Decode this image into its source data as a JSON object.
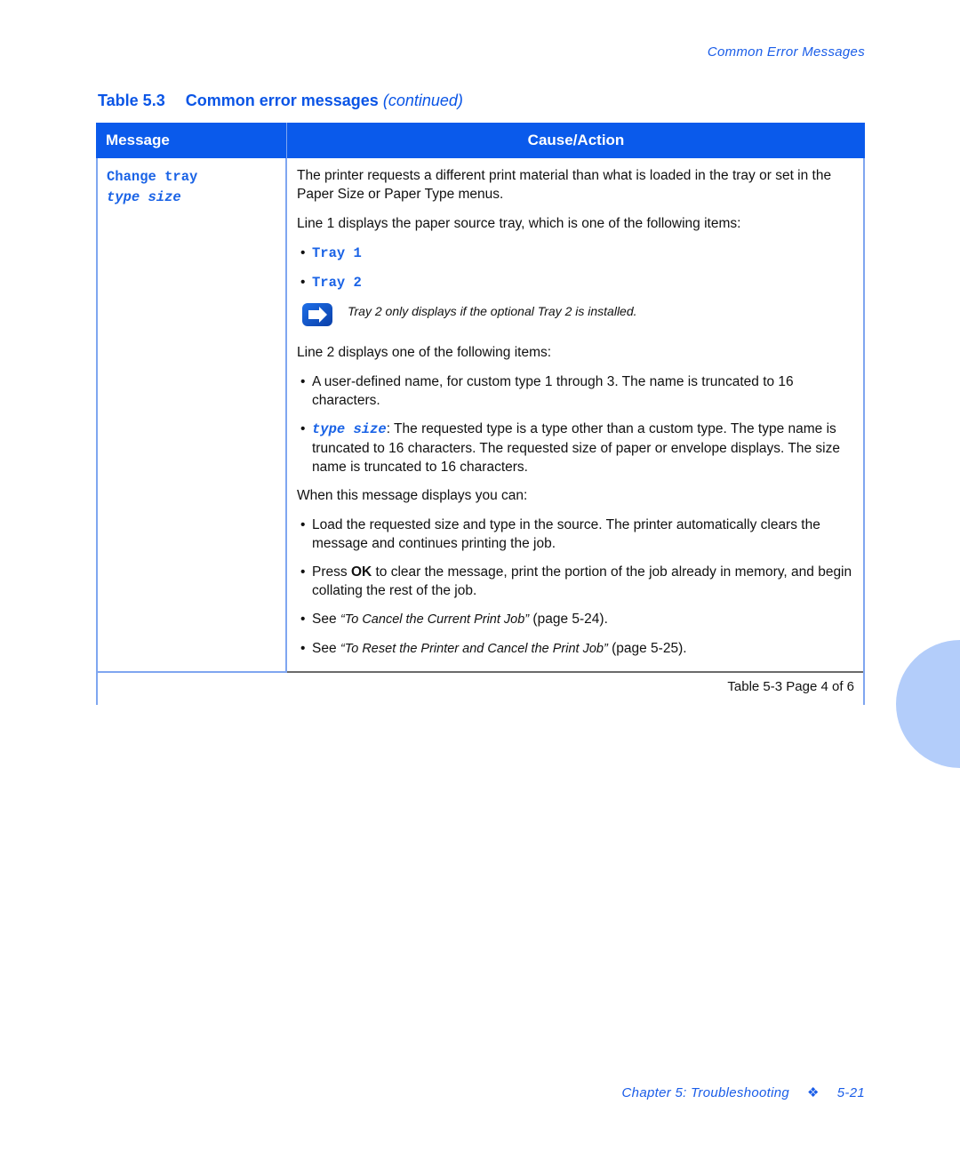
{
  "running_header": "Common Error Messages",
  "caption": {
    "number": "Table 5.3",
    "title": "Common error messages",
    "continued": "(continued)"
  },
  "table": {
    "headers": {
      "message": "Message",
      "cause": "Cause/Action"
    },
    "row": {
      "message_line1": "Change tray",
      "message_line2": "type size",
      "p1": "The printer requests a different print material than what is loaded in the tray or set in the Paper Size or Paper Type menus.",
      "p2": "Line 1 displays the paper source tray, which is one of the following items:",
      "tray_items": [
        "Tray 1",
        "Tray 2"
      ],
      "note": "Tray 2 only displays if the optional Tray 2 is installed.",
      "p3": "Line 2 displays one of the following items:",
      "line2_item1": "A user-defined name, for custom type 1 through 3. The name is truncated to 16 characters.",
      "line2_item2_code": "type size",
      "line2_item2_text": ": The requested type is a type other than a custom type. The type name is truncated to 16 characters. The requested size of paper or envelope displays. The size name is truncated to 16 characters.",
      "p4": "When this message displays you can:",
      "action1": "Load the requested size and type in the source. The printer automatically clears the message and continues printing the job.",
      "action2_pre": "Press ",
      "action2_bold": "OK",
      "action2_post": " to clear the message, print the portion of the job already in memory, and begin collating the rest of the job.",
      "action3_pre": "See ",
      "action3_ref": "“To Cancel the Current Print Job”",
      "action3_post": " (page 5-24).",
      "action4_pre": "See ",
      "action4_ref": "“To Reset the Printer and Cancel the Print Job”",
      "action4_post": " (page 5-25)."
    },
    "footer": "Table 5-3  Page 4 of 6"
  },
  "footer": {
    "chapter": "Chapter 5: Troubleshooting",
    "separator_icon": "❖",
    "page": "5-21"
  },
  "colors": {
    "accent": "#0a5aeb",
    "text_blue": "#1a63e6",
    "side_tab": "#b3cdfa"
  }
}
